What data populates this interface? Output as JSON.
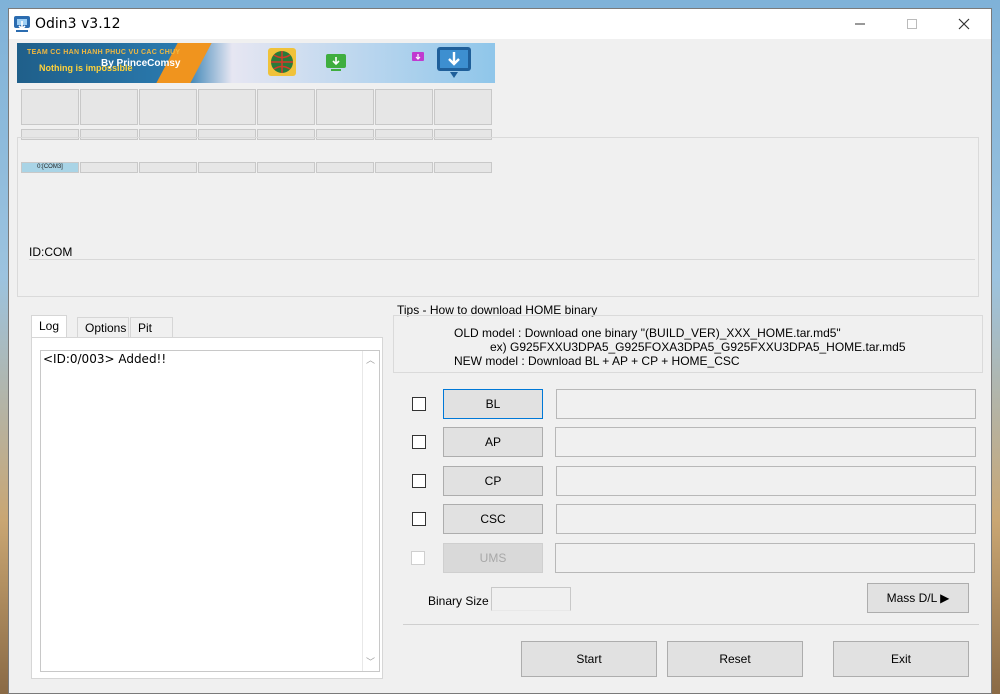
{
  "window": {
    "title": "Odin3 v3.12"
  },
  "banner": {
    "line1": "TEAM CC HAN HANH PHUC VU CAC CHUY",
    "line2": "Nothing is impossible",
    "by": "By PrinceComsy"
  },
  "ports": {
    "com_label": "0:[COM3]",
    "idcom_label": "ID:COM"
  },
  "tabs": [
    {
      "label": "Log"
    },
    {
      "label": "Options"
    },
    {
      "label": "Pit"
    }
  ],
  "log": {
    "text": "<ID:0/003> Added!!"
  },
  "tips": {
    "title": "Tips - How to download HOME binary",
    "line1": "OLD model  : Download one binary    \"(BUILD_VER)_XXX_HOME.tar.md5\"",
    "line2": "ex) G925FXXU3DPA5_G925FOXA3DPA5_G925FXXU3DPA5_HOME.tar.md5",
    "line3": "NEW model : Download BL + AP + CP + HOME_CSC"
  },
  "files": [
    {
      "label": "BL"
    },
    {
      "label": "AP"
    },
    {
      "label": "CP"
    },
    {
      "label": "CSC"
    },
    {
      "label": "UMS"
    }
  ],
  "binary_size": {
    "label": "Binary Size"
  },
  "mass_dl": {
    "label": "Mass D/L ▶"
  },
  "actions": {
    "start": "Start",
    "reset": "Reset",
    "exit": "Exit"
  }
}
